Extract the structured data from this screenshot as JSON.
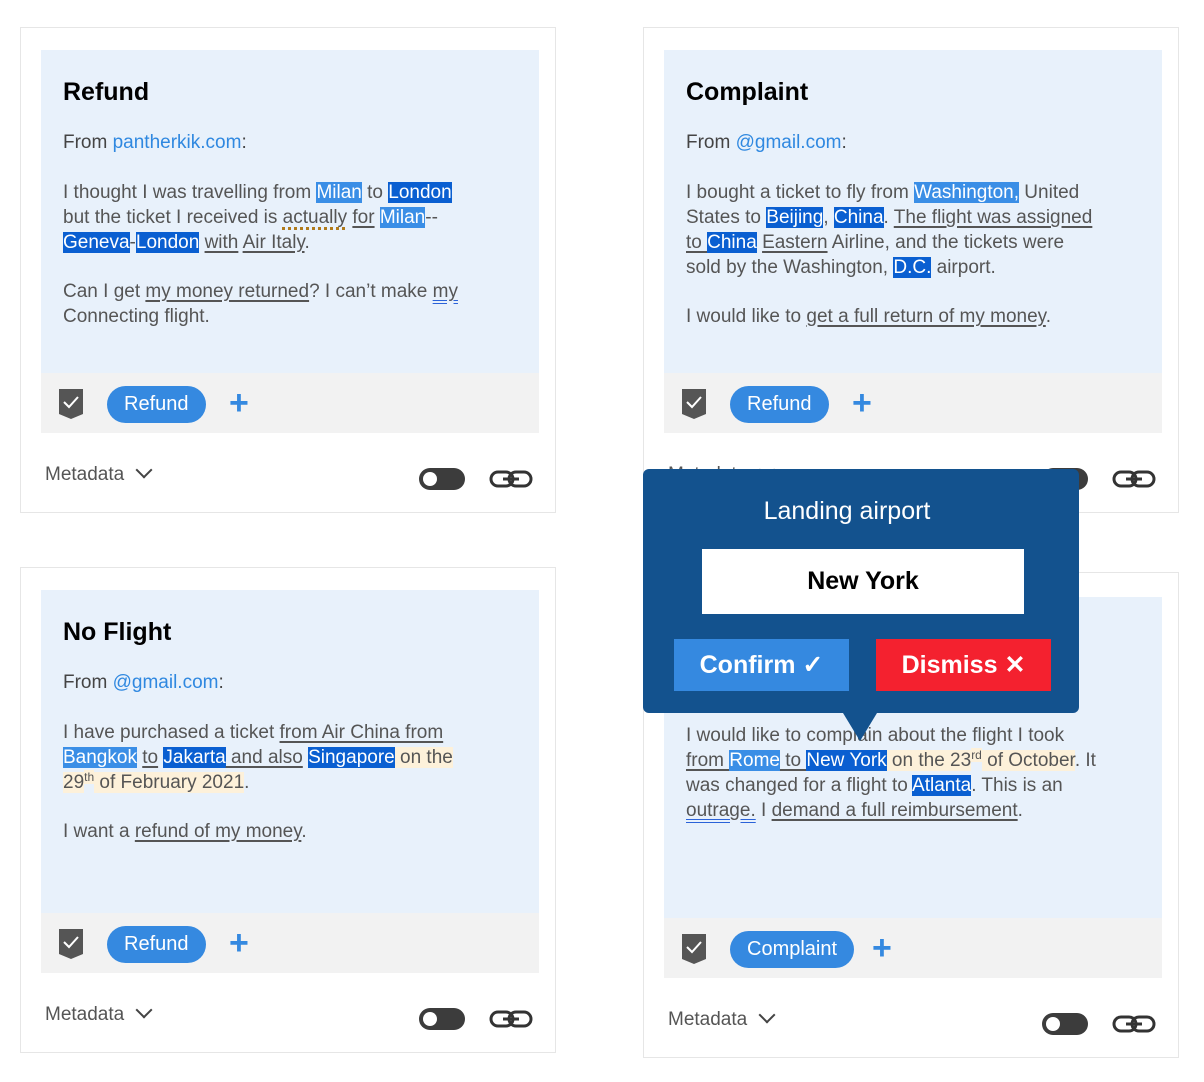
{
  "colors": {
    "highlight_light": "#3a8ee6",
    "highlight_dark": "#0a5fd1",
    "tag": "#3589e0",
    "popup": "#13528e",
    "dismiss": "#f4212f",
    "date_bg": "#fdf1da"
  },
  "cards": [
    {
      "title": "Refund",
      "from_label": "From ",
      "from_domain": "pantherkik.com",
      "from_suffix": ":",
      "tag": "Refund",
      "metadata": "Metadata",
      "paragraphs": [
        [
          {
            "t": "I thought I was travelling from ",
            "s": "p"
          },
          {
            "t": "Milan",
            "s": "hl"
          },
          {
            "t": " to ",
            "s": "p"
          },
          {
            "t": "London",
            "s": "hl2"
          },
          {
            "t": "\nbut the ticket I received is ",
            "s": "p"
          },
          {
            "t": "actually",
            "s": "uld"
          },
          {
            "t": " ",
            "s": "p"
          },
          {
            "t": "for",
            "s": "ul"
          },
          {
            "t": " ",
            "s": "p"
          },
          {
            "t": "Milan",
            "s": "hl"
          },
          {
            "t": "--\n",
            "s": "p"
          },
          {
            "t": "Geneva",
            "s": "hl2"
          },
          {
            "t": "-",
            "s": "p"
          },
          {
            "t": "London",
            "s": "hl2"
          },
          {
            "t": " ",
            "s": "p"
          },
          {
            "t": "with",
            "s": "ul"
          },
          {
            "t": " ",
            "s": "p"
          },
          {
            "t": "Air Italy",
            "s": "ul"
          },
          {
            "t": ".",
            "s": "p"
          }
        ],
        [
          {
            "t": "Can I get ",
            "s": "p"
          },
          {
            "t": "my money returned",
            "s": "ul"
          },
          {
            "t": "? I can’t make ",
            "s": "p"
          },
          {
            "t": "my",
            "s": "ulb"
          },
          {
            "t": "\nConnecting flight.",
            "s": "p"
          }
        ]
      ]
    },
    {
      "title": "Complaint",
      "from_label": "From ",
      "from_domain": "@gmail.com",
      "from_suffix": ":",
      "tag": "Refund",
      "metadata": "Metadata",
      "paragraphs": [
        [
          {
            "t": "I bought a ticket to fly from ",
            "s": "p"
          },
          {
            "t": "Washington,",
            "s": "hl"
          },
          {
            "t": " United\nStates to ",
            "s": "p"
          },
          {
            "t": "Beijing",
            "s": "hl2"
          },
          {
            "t": ", ",
            "s": "p"
          },
          {
            "t": "China",
            "s": "hl2"
          },
          {
            "t": ". ",
            "s": "p"
          },
          {
            "t": "The flight was assigned\nto ",
            "s": "ul"
          },
          {
            "t": "China",
            "s": "hl2"
          },
          {
            "t": "  ",
            "s": "p"
          },
          {
            "t": "Eastern",
            "s": "ul"
          },
          {
            "t": " Airline, and the tickets were\nsold by the Washington, ",
            "s": "p"
          },
          {
            "t": "D.C.",
            "s": "hl2"
          },
          {
            "t": " airport.",
            "s": "p"
          }
        ],
        [
          {
            "t": "I would like to ",
            "s": "p"
          },
          {
            "t": "get a full return of my money",
            "s": "ul"
          },
          {
            "t": ".",
            "s": "p"
          }
        ]
      ]
    },
    {
      "title": "No Flight",
      "from_label": "From ",
      "from_domain": "@gmail.com",
      "from_suffix": ":",
      "tag": "Refund",
      "metadata": "Metadata",
      "paragraphs": [
        [
          {
            "t": "I have purchased a ticket ",
            "s": "p"
          },
          {
            "t": "from Air China from",
            "s": "ul"
          },
          {
            "t": "\n",
            "s": "p"
          },
          {
            "t": "Bangkok",
            "s": "hl"
          },
          {
            "t": " ",
            "s": "p"
          },
          {
            "t": "to",
            "s": "ul"
          },
          {
            "t": " ",
            "s": "p"
          },
          {
            "t": "Jakarta",
            "s": "hl2"
          },
          {
            "t": " and also",
            "s": "ul"
          },
          {
            "t": " ",
            "s": "p"
          },
          {
            "t": "Singapore",
            "s": "hl2"
          },
          {
            "t": " on the\n29",
            "s": "date"
          },
          {
            "t": "th",
            "s": "sup"
          },
          {
            "t": " of February 2021",
            "s": "date"
          },
          {
            "t": ".",
            "s": "p"
          }
        ],
        [
          {
            "t": "I want a ",
            "s": "p"
          },
          {
            "t": "refund of my money",
            "s": "ul"
          },
          {
            "t": ".",
            "s": "p"
          }
        ]
      ]
    },
    {
      "tag": "Complaint",
      "metadata": "Metadata",
      "paragraphs": [
        [
          {
            "t": "I would like to complain about the flight I took\n",
            "s": "p"
          },
          {
            "t": "from ",
            "s": "ul"
          },
          {
            "t": "Rome",
            "s": "hl"
          },
          {
            "t": " to ",
            "s": "ul"
          },
          {
            "t": "New York",
            "s": "hl2"
          },
          {
            "t": " on the 23",
            "s": "date"
          },
          {
            "t": "rd",
            "s": "sup"
          },
          {
            "t": " of October",
            "s": "date"
          },
          {
            "t": ". It\nwas changed for a flight to ",
            "s": "p"
          },
          {
            "t": "Atlanta",
            "s": "hl2"
          },
          {
            "t": ". This is an\n",
            "s": "p"
          },
          {
            "t": "outrage.",
            "s": "ulb"
          },
          {
            "t": " I ",
            "s": "p"
          },
          {
            "t": "demand a full reimbursement",
            "s": "ul"
          },
          {
            "t": ".",
            "s": "p"
          }
        ]
      ]
    }
  ],
  "popup": {
    "title": "Landing airport",
    "value": "New York",
    "confirm": "Confirm",
    "dismiss": "Dismiss"
  }
}
